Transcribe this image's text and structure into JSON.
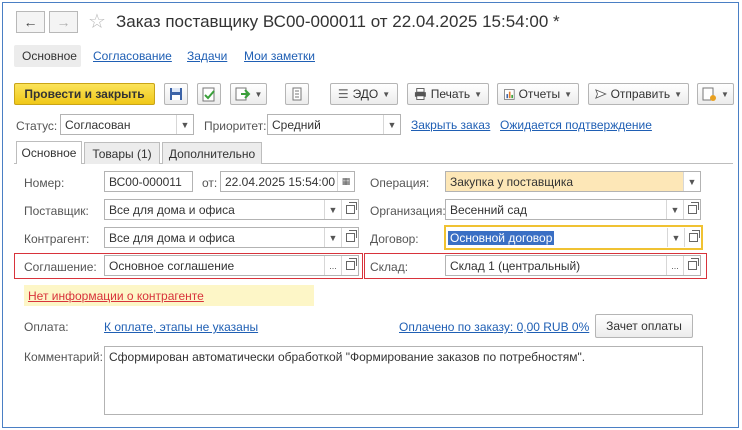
{
  "window": {
    "title": "Заказ поставщику ВС00-000011 от 22.04.2025 15:54:00 *",
    "back_icon": "arrow-left-icon",
    "forward_icon": "arrow-right-icon",
    "favorite_icon": "star-outline-icon"
  },
  "top_tabs": {
    "main": "Основное",
    "approval": "Согласование",
    "tasks": "Задачи",
    "notes": "Мои заметки"
  },
  "toolbar": {
    "post_and_close": "Провести и закрыть",
    "edo": "ЭДО",
    "print": "Печать",
    "reports": "Отчеты",
    "send": "Отправить"
  },
  "status_row": {
    "status_label": "Статус:",
    "status_value": "Согласован",
    "priority_label": "Приоритет:",
    "priority_value": "Средний",
    "close_order_link": "Закрыть заказ",
    "awaiting_link": "Ожидается подтверждение"
  },
  "form_tabs": {
    "main": "Основное",
    "goods": "Товары (1)",
    "additional": "Дополнительно"
  },
  "form": {
    "number_label": "Номер:",
    "number_value": "ВС00-000011",
    "date_label": "от:",
    "date_value": "22.04.2025 15:54:00",
    "operation_label": "Операция:",
    "operation_value": "Закупка у поставщика",
    "supplier_label": "Поставщик:",
    "supplier_value": "Все для дома и офиса",
    "organization_label": "Организация:",
    "organization_value": "Весенний сад",
    "counterparty_label": "Контрагент:",
    "counterparty_value": "Все для дома и офиса",
    "contract_label": "Договор:",
    "contract_value": "Основной договор",
    "agreement_label": "Соглашение:",
    "agreement_value": "Основное соглашение",
    "warehouse_label": "Склад:",
    "warehouse_value": "Склад 1 (центральный)",
    "warning": "Нет информации о контрагенте",
    "payment_label": "Оплата:",
    "payment_link": "К оплате, этапы не указаны",
    "paid_link": "Оплачено по заказу: 0,00 RUB 0%",
    "payment_offset_button": "Зачет оплаты",
    "comment_label": "Комментарий:",
    "comment_value": "Сформирован автоматически обработкой \"Формирование заказов по потребностям\"."
  },
  "colors": {
    "accent_link": "#1f5fb4",
    "primary_button": "#f3cf29",
    "highlight_field": "#fde7b7",
    "warning_bg": "#fdf6c7",
    "warning_text": "#d8333b",
    "selection": "#3a6fc4",
    "frame_border": "#4a7fc4"
  }
}
